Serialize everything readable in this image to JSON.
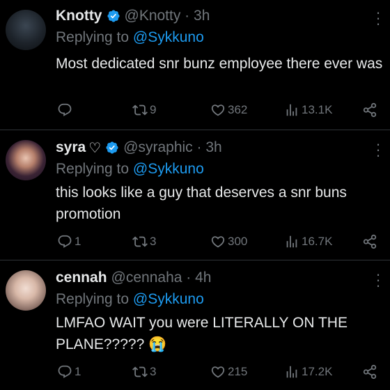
{
  "tweets": [
    {
      "name": "Knotty",
      "handle": "@Knotty · 3h",
      "replying_prefix": "Replying to ",
      "replying_handle": "@Sykkuno",
      "text": "Most dedicated snr bunz employee there ever was",
      "replies": "",
      "retweets": "9",
      "likes": "362",
      "views": "13.1K"
    },
    {
      "name": "syra",
      "name_suffix": "♡",
      "handle": "@syraphic · 3h",
      "replying_prefix": "Replying to ",
      "replying_handle": "@Sykkuno",
      "text": "this looks like a guy that deserves a snr buns promotion",
      "replies": "1",
      "retweets": "3",
      "likes": "300",
      "views": "16.7K"
    },
    {
      "name": "cennah",
      "handle": "@cennaha · 4h",
      "replying_prefix": "Replying to ",
      "replying_handle": "@Sykkuno",
      "text": "LMFAO WAIT you were LITERALLY ON THE PLANE????? 😭",
      "replies": "1",
      "retweets": "3",
      "likes": "215",
      "views": "17.2K"
    }
  ],
  "colors": {
    "background": "#000000",
    "text": "#e7e9ea",
    "muted": "#71767b",
    "link": "#1d9bf0",
    "divider": "#2f3336"
  },
  "icons": [
    "verified-badge-icon",
    "more-options-icon",
    "reply-icon",
    "retweet-icon",
    "like-icon",
    "views-icon",
    "share-icon"
  ]
}
